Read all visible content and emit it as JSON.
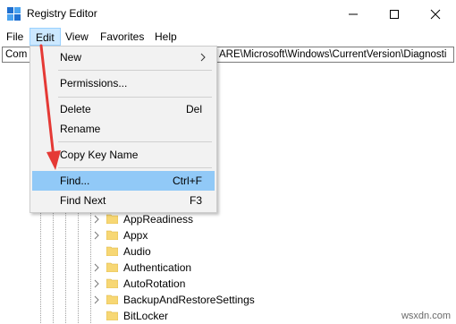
{
  "window": {
    "title": "Registry Editor",
    "controls": [
      "minimize-icon",
      "maximize-icon",
      "close-icon"
    ]
  },
  "menubar": {
    "items": [
      "File",
      "Edit",
      "View",
      "Favorites",
      "Help"
    ],
    "active": "Edit"
  },
  "address": {
    "prefix": "Com",
    "path": "ARE\\Microsoft\\Windows\\CurrentVersion\\Diagnosti"
  },
  "edit_menu": {
    "items": [
      {
        "label": "New",
        "shortcut": "",
        "submenu": true
      },
      {
        "label": "Permissions...",
        "shortcut": ""
      },
      {
        "label": "Delete",
        "shortcut": "Del"
      },
      {
        "label": "Rename",
        "shortcut": ""
      },
      {
        "label": "Copy Key Name",
        "shortcut": ""
      },
      {
        "label": "Find...",
        "shortcut": "Ctrl+F",
        "highlighted": true
      },
      {
        "label": "Find Next",
        "shortcut": "F3"
      }
    ]
  },
  "tree": {
    "items": [
      "AppReadiness",
      "Appx",
      "Audio",
      "Authentication",
      "AutoRotation",
      "BackupAndRestoreSettings",
      "BitLocker"
    ]
  },
  "annotation": {
    "color": "#e53935",
    "icon": "red-arrow-icon"
  },
  "watermark": "wsxdn.com"
}
